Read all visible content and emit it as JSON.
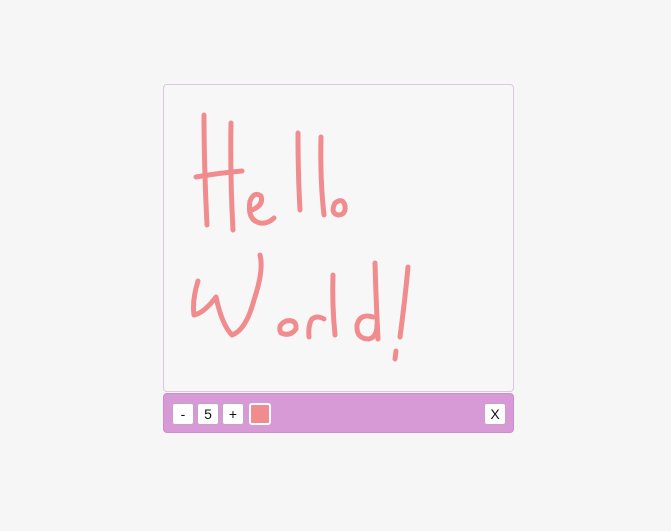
{
  "canvas": {
    "stroke_color": "#f08c8e"
  },
  "toolbar": {
    "decrease_label": "-",
    "size_value": "5",
    "increase_label": "+",
    "color_swatch": "#f08c8e",
    "close_label": "X",
    "background": "#d89ad6"
  }
}
